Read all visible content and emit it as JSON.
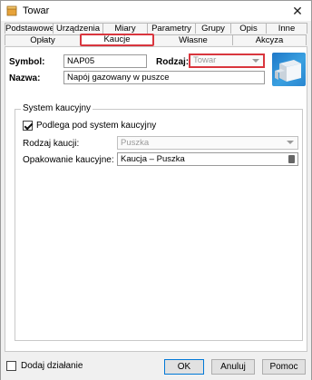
{
  "window": {
    "title": "Towar",
    "close_glyph": "✕"
  },
  "tabs_row1": [
    "Podstawowe",
    "Urządzenia",
    "Miary",
    "Parametry",
    "Grupy",
    "Opis",
    "Inne"
  ],
  "tabs_row2": [
    "Opłaty",
    "Kaucje",
    "Własne",
    "Akcyza"
  ],
  "active_tab": "Kaucje",
  "header": {
    "symbol_label": "Symbol:",
    "symbol_value": "NAP05",
    "rodzaj_label": "Rodzaj:",
    "rodzaj_value": "Towar",
    "nazwa_label": "Nazwa:",
    "nazwa_value": "Napój gazowany w puszce"
  },
  "deposit": {
    "group_title": "System kaucyjny",
    "checkbox_label": "Podlega pod system kaucyjny",
    "checkbox_checked": true,
    "rodzaj_kaucji_label": "Rodzaj kaucji:",
    "rodzaj_kaucji_value": "Puszka",
    "opakowanie_label": "Opakowanie kaucyjne:",
    "opakowanie_value": "Kaucja – Puszka"
  },
  "footer": {
    "add_action_label": "Dodaj działanie",
    "add_action_checked": false,
    "ok_label": "OK",
    "cancel_label": "Anuluj",
    "help_label": "Pomoc"
  },
  "colors": {
    "accent_red": "#d9363e",
    "focus_blue": "#0078d7",
    "product_blue": "#1f78c8"
  }
}
